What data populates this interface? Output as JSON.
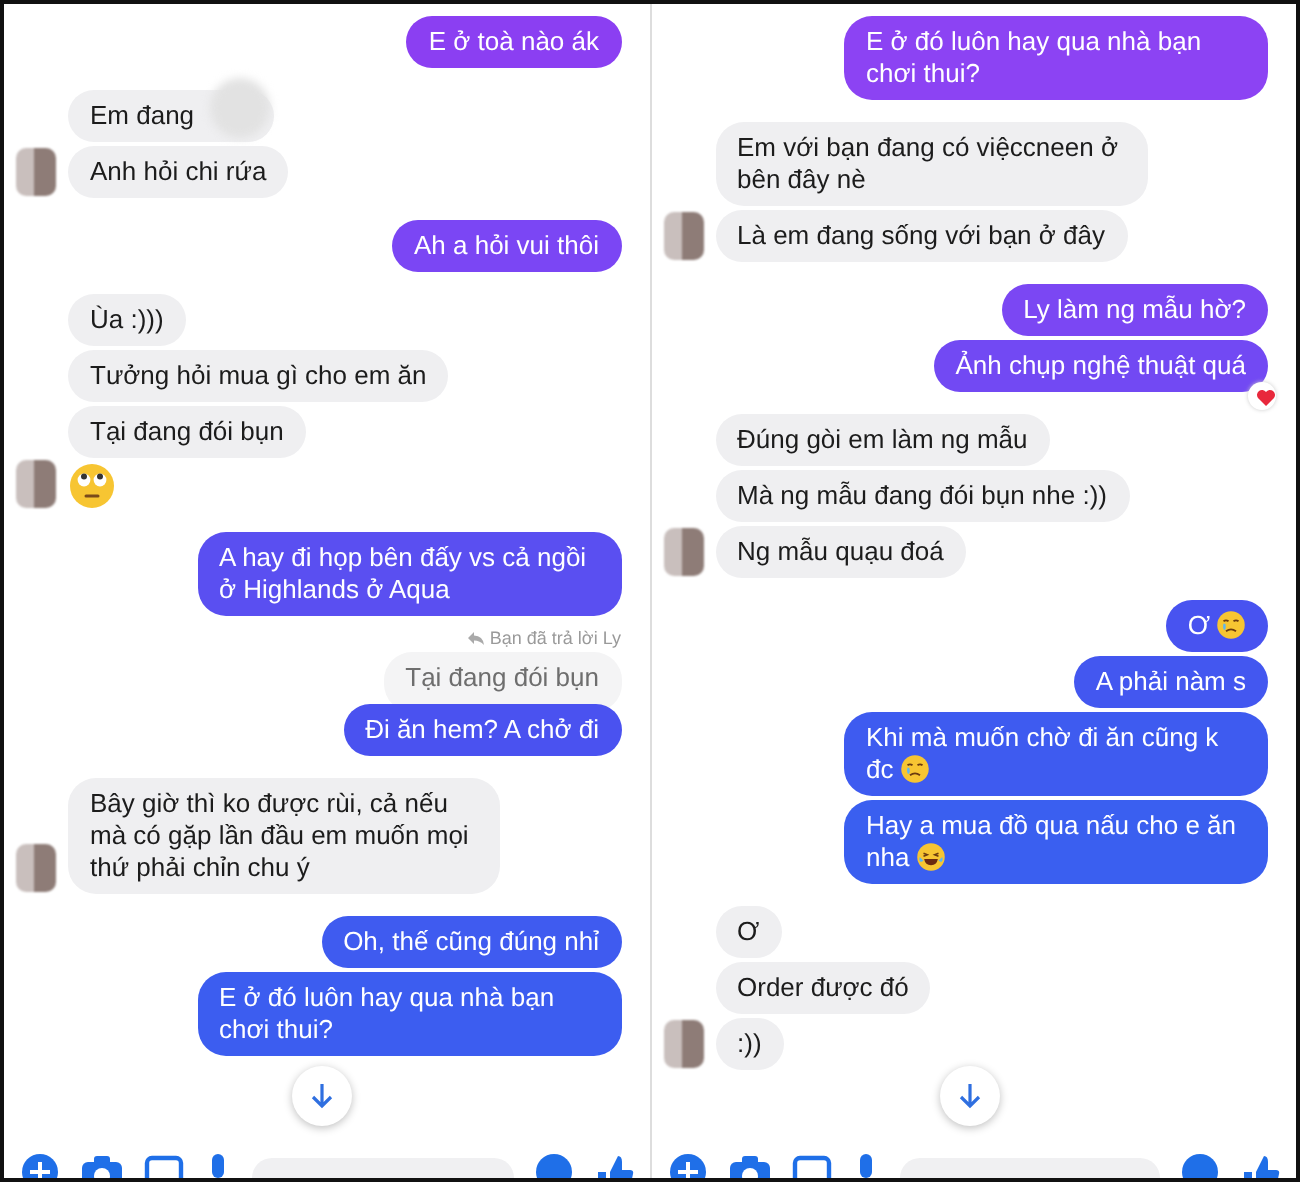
{
  "panels": [
    {
      "groups": [
        {
          "kind": "sent",
          "messages": [
            {
              "kind": "text",
              "text": "E ở toà nào ák",
              "color": "#8b3ff2"
            }
          ]
        },
        {
          "kind": "received",
          "messages": [
            {
              "kind": "redacted",
              "text": "Em đang"
            },
            {
              "kind": "text",
              "text": "Anh hỏi chi rứa"
            }
          ]
        },
        {
          "kind": "sent",
          "messages": [
            {
              "kind": "text",
              "text": "Ah a hỏi vui thôi",
              "color": "#7b46f4"
            }
          ]
        },
        {
          "kind": "received",
          "messages": [
            {
              "kind": "text",
              "text": "Ùa :)))"
            },
            {
              "kind": "text",
              "text": "Tưởng hỏi mua gì cho em ăn"
            },
            {
              "kind": "text",
              "text": "Tại đang đói bụn"
            },
            {
              "kind": "emoji",
              "emoji": {
                "kind": "eye-roll"
              }
            }
          ]
        },
        {
          "kind": "sent",
          "messages": [
            {
              "kind": "text",
              "text": "A hay đi họp bên đấy vs cả ngồi ở Highlands ở Aqua",
              "color": "#5a4ff1"
            },
            {
              "kind": "reply",
              "label": "Bạn đã trả lời Ly",
              "quote": "Tại đang đói bụn"
            },
            {
              "kind": "text",
              "text": "Đi ăn hem? A chở đi",
              "color": "#4a52f0"
            }
          ]
        },
        {
          "kind": "received",
          "messages": [
            {
              "kind": "text",
              "text": "Bây giờ thì ko được rùi, cả nếu mà có gặp lần đầu em muốn mọi thứ phải chỉn chu ý"
            }
          ]
        },
        {
          "kind": "sent",
          "messages": [
            {
              "kind": "text",
              "text": "Oh, thế cũng đúng nhỉ",
              "color": "#3f5bf0"
            },
            {
              "kind": "text",
              "text": "E ở đó luôn hay qua nhà bạn chơi thui?",
              "color": "#3c5df0"
            }
          ]
        }
      ]
    },
    {
      "groups": [
        {
          "kind": "sent",
          "messages": [
            {
              "kind": "text",
              "text": "E ở đó luôn hay qua nhà bạn chơi thui?",
              "color": "#8c43f3"
            }
          ]
        },
        {
          "kind": "received",
          "messages": [
            {
              "kind": "text",
              "text": "Em với bạn đang có việccneen ở bên đây nè"
            },
            {
              "kind": "text",
              "text": "Là em đang sống với bạn ở đây"
            }
          ]
        },
        {
          "kind": "sent",
          "messages": [
            {
              "kind": "text",
              "text": "Ly làm ng mẫu hờ?",
              "color": "#7b47f3"
            },
            {
              "kind": "text",
              "text": "Ảnh chụp nghệ thuật quá",
              "color": "#7249f3",
              "reaction": {
                "kind": "heart"
              }
            }
          ]
        },
        {
          "kind": "received",
          "messages": [
            {
              "kind": "text",
              "text": "Đúng gòi em làm ng mẫu"
            },
            {
              "kind": "text",
              "text": "Mà ng mẫu đang đói bụn nhe :))"
            },
            {
              "kind": "text",
              "text": "Ng mẫu quạu đoá"
            }
          ]
        },
        {
          "kind": "sent",
          "messages": [
            {
              "kind": "text",
              "text": "Ơ",
              "emoji": {
                "kind": "crying"
              },
              "color": "#4853f0"
            },
            {
              "kind": "text",
              "text": "A phải nàm s",
              "color": "#4357f0"
            },
            {
              "kind": "text",
              "text": "Khi mà muốn chờ đi ăn cũng k đc",
              "emoji": {
                "kind": "crying"
              },
              "color": "#3e5bf0"
            },
            {
              "kind": "text",
              "text": "Hay a mua đồ qua nấu cho e ăn nha",
              "emoji": {
                "kind": "laughing"
              },
              "color": "#3a5ff0"
            }
          ]
        },
        {
          "kind": "received",
          "messages": [
            {
              "kind": "text",
              "text": "Ơ"
            },
            {
              "kind": "text",
              "text": "Order được đó"
            },
            {
              "kind": "text",
              "text": ":))"
            }
          ]
        }
      ]
    }
  ]
}
